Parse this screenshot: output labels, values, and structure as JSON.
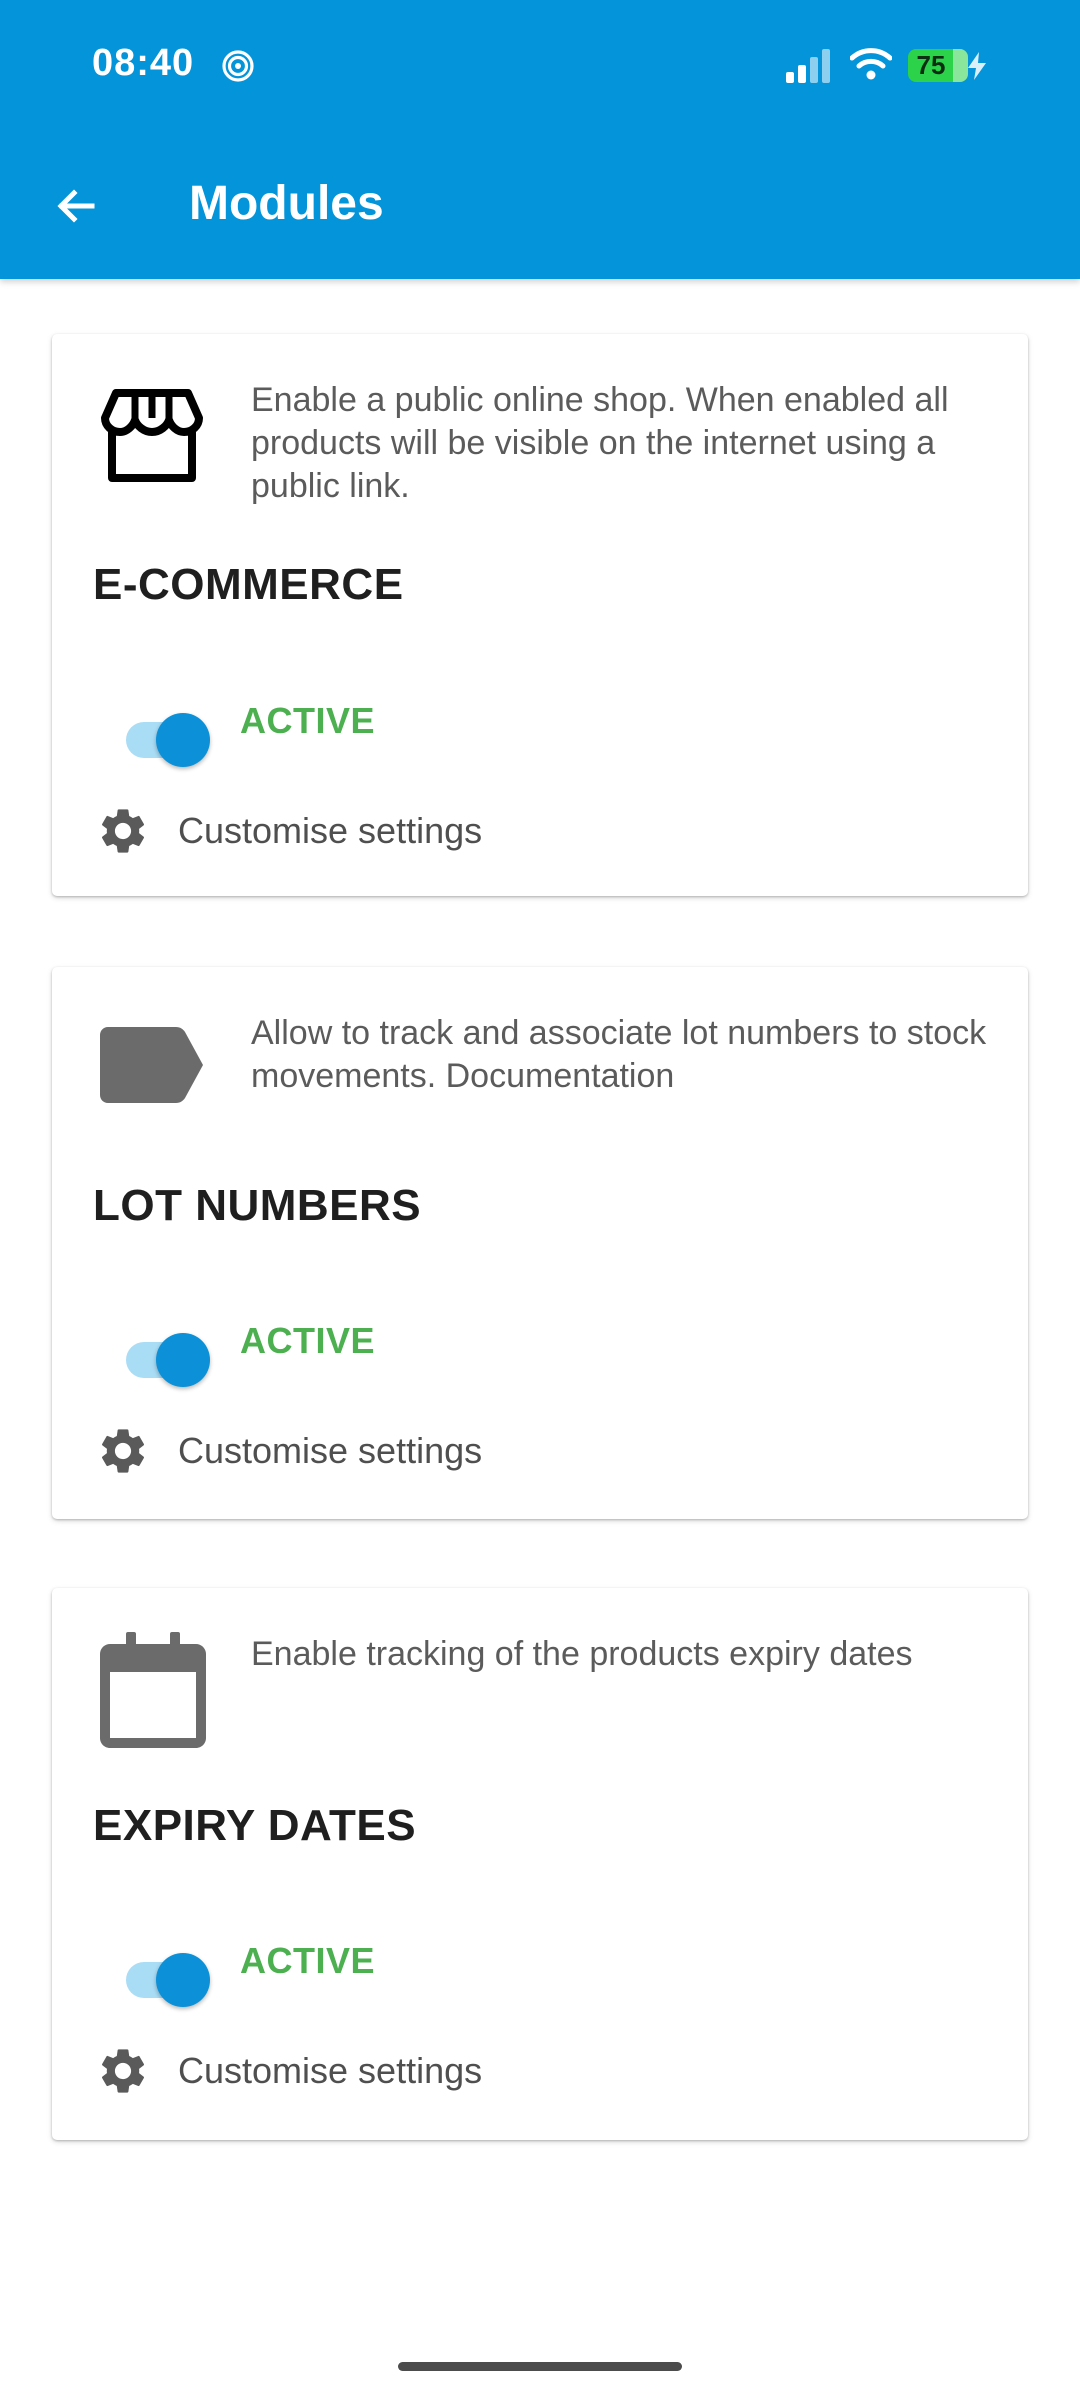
{
  "status_bar": {
    "time": "08:40",
    "battery": "75"
  },
  "app_bar": {
    "title": "Modules"
  },
  "modules": [
    {
      "icon": "store-icon",
      "description": "Enable a public online shop. When enabled all products will be visible on the internet using a public link.",
      "title": "E-COMMERCE",
      "status": "ACTIVE",
      "settings_label": "Customise settings"
    },
    {
      "icon": "label-icon",
      "description": "Allow to track and associate lot numbers to stock movements. Documentation",
      "title": "LOT NUMBERS",
      "status": "ACTIVE",
      "settings_label": "Customise settings"
    },
    {
      "icon": "calendar-icon",
      "description": "Enable tracking of the products expiry dates",
      "title": "EXPIRY DATES",
      "status": "ACTIVE",
      "settings_label": "Customise settings"
    }
  ],
  "colors": {
    "app_bar": "#0394d9",
    "active_text": "#4caf50",
    "toggle_thumb": "#0c90d8",
    "toggle_track": "#a9dcf5"
  }
}
